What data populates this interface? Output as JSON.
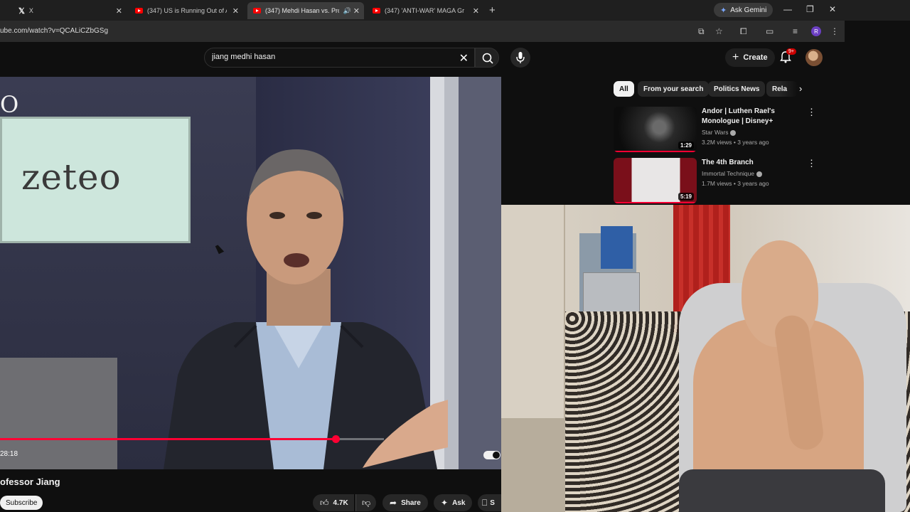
{
  "browser": {
    "tabs": [
      {
        "label": "X",
        "type": "x"
      },
      {
        "label": "(347) US is Running Out of Am",
        "type": "youtube"
      },
      {
        "label": "(347) Mehdi Hasan vs. Profe",
        "type": "youtube",
        "active": true
      },
      {
        "label": "(347) 'ANTI-WAR' MAGA Grifte",
        "type": "youtube"
      }
    ],
    "ask_gemini": "Ask Gemini",
    "url": "ube.com/watch?v=QCALiCZbGSg",
    "profile_initial": "R"
  },
  "youtube": {
    "search_value": "jiang medhi hasan",
    "create_label": "Create",
    "notifications_badge": "9+"
  },
  "player": {
    "progress_fraction": 0.67,
    "time_text": "28:18",
    "board_logo": "zeteo",
    "corner_logo": "O"
  },
  "video_info": {
    "title_fragment": "ofessor Jiang",
    "subscribe_label": "Subscribe",
    "likes": "4.7K",
    "share_label": "Share",
    "ask_label": "Ask",
    "save_label_fragment": "S"
  },
  "sidebar": {
    "chips": [
      "All",
      "From your search",
      "Politics News",
      "Rela"
    ],
    "recommendations": [
      {
        "title": "Andor | Luthen Rael's Monologue | Disney+",
        "channel": "Star Wars",
        "meta": "3.2M views • 3 years ago",
        "duration": "1:29",
        "watched_fraction": 1.0
      },
      {
        "title": "The 4th Branch",
        "channel": "Immortal Technique",
        "meta": "1.7M views • 3 years ago",
        "duration": "5:19",
        "watched_fraction": 1.0
      }
    ]
  },
  "colors": {
    "accent_red": "#ff0033",
    "background": "#0f0f0f"
  }
}
